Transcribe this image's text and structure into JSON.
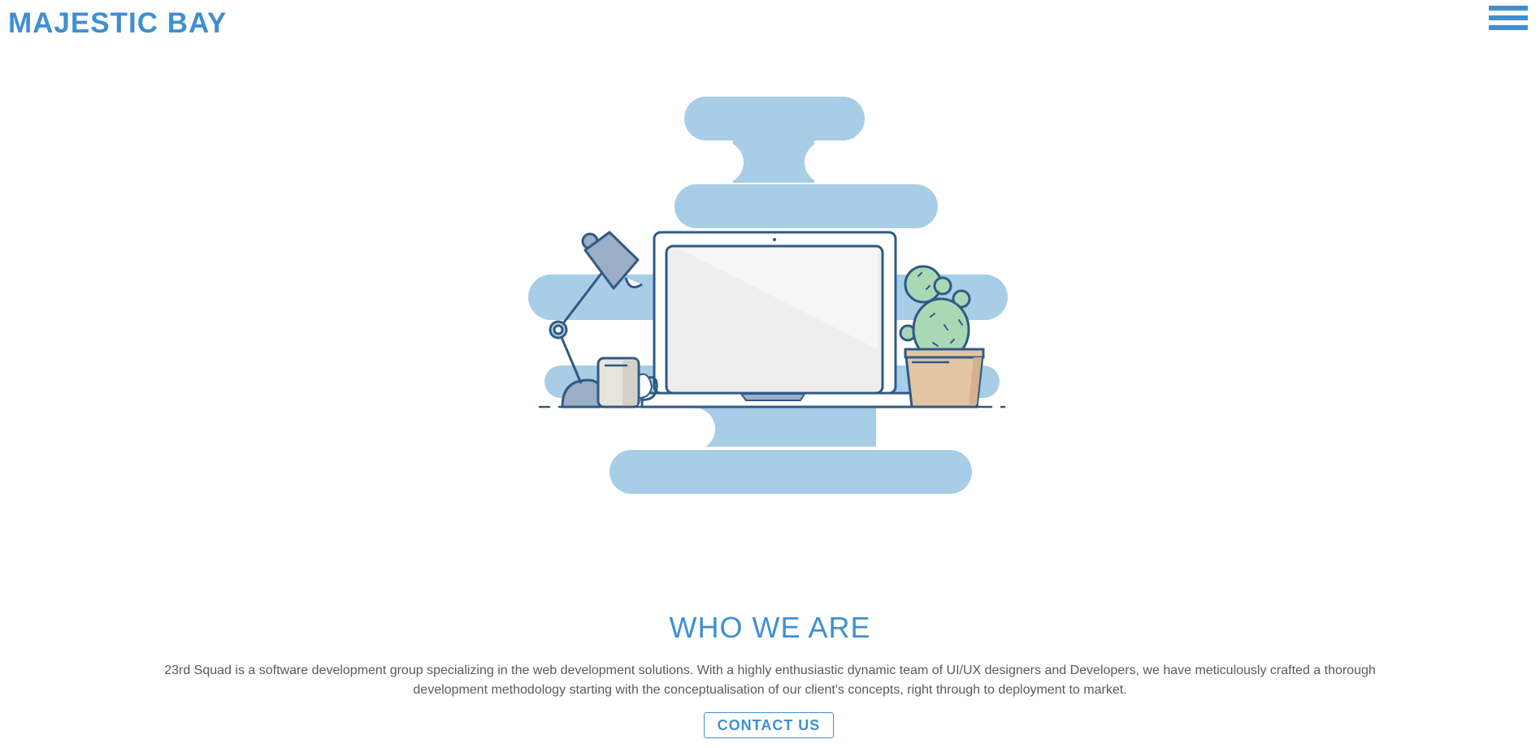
{
  "header": {
    "brand": "MAJESTIC BAY",
    "menu_icon": "hamburger-menu-icon"
  },
  "hero": {
    "illustration": "desk-with-laptop-lamp-mug-cactus",
    "colors": {
      "cloud": "#a8cde6",
      "outline": "#2f5a85",
      "screen": "#eeeeee",
      "lamp": "#9aafc7",
      "cactus": "#a9d9b4",
      "pot": "#e3c4a3",
      "mug": "#e7e4dc"
    }
  },
  "about": {
    "title": "WHO WE ARE",
    "text": "23rd Squad is a software development group specializing in the web development solutions. With a highly enthusiastic dynamic team of UI/UX designers and Developers, we have meticulously crafted a thorough development methodology starting with the conceptualisation of our client's concepts, right through to deployment to market.",
    "cta_label": "CONTACT US"
  },
  "colors": {
    "accent": "#3f8fd2",
    "text": "#555b60",
    "background": "#ffffff"
  }
}
